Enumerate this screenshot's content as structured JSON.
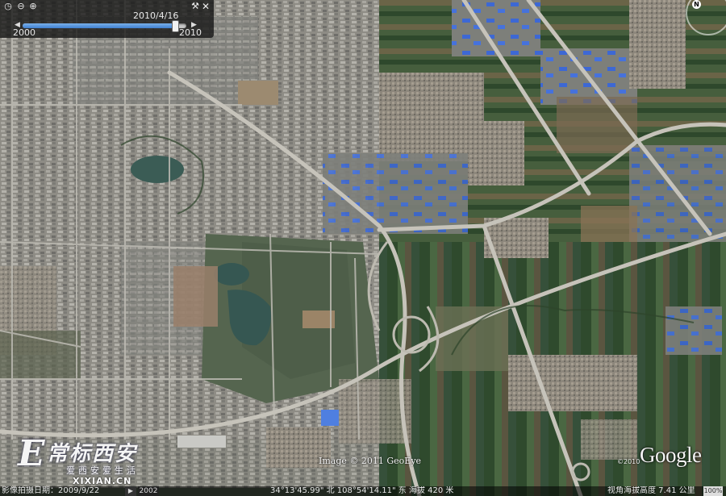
{
  "historical_imagery": {
    "current_date": "2010/4/16",
    "start_year": "2000",
    "end_year": "2010",
    "slider_position": 0.93,
    "close_glyph": "✕"
  },
  "icons": {
    "clock": "clock-icon",
    "zoom_out": "zoom-out-icon",
    "zoom_in": "zoom-in-icon",
    "settings": "wrench-icon",
    "close": "close-icon",
    "compass": "north-arrow-icon"
  },
  "compass": {
    "label": "N"
  },
  "credits": {
    "copyright": "Image © 2011 GeoEye",
    "google_logo": "Google",
    "google_year": "©2010"
  },
  "site_logo": {
    "letter": "E",
    "name": "常标西安",
    "slogan": "爱西安爱生活",
    "url": "XIXIAN.CN"
  },
  "status_bar": {
    "capture_date": "影像拍摄日期：2009/9/22",
    "tour_button": "▶",
    "stream_year": "2002",
    "coordinates": "34°13'45.99\" 北  108°54'14.11\" 东 海拔  420 米",
    "eye_altitude": "视角海拔高度  7.41 公里",
    "streaming": "100%"
  },
  "colors": {
    "field_green": "#3d5a38",
    "urban_grey": "#8d8c86",
    "road": "#b9b7b0",
    "water": "#36574f",
    "roof_blue": "#3e6ad6"
  }
}
